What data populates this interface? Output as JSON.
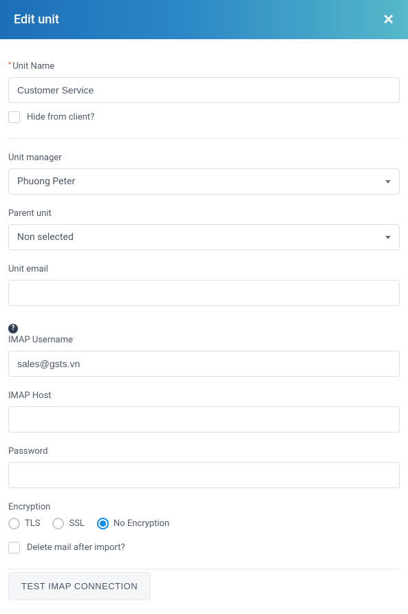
{
  "header": {
    "title": "Edit unit"
  },
  "form": {
    "unitName": {
      "label": "Unit Name",
      "value": "Customer Service",
      "required": true
    },
    "hideFromClient": {
      "label": "Hide from client?",
      "checked": false
    },
    "unitManager": {
      "label": "Unit manager",
      "selected": "Phuong Peter"
    },
    "parentUnit": {
      "label": "Parent unit",
      "selected": "Non selected"
    },
    "unitEmail": {
      "label": "Unit email",
      "value": ""
    },
    "imapUsername": {
      "label": "IMAP Username",
      "value": "sales@gsts.vn"
    },
    "imapHost": {
      "label": "IMAP Host",
      "value": ""
    },
    "password": {
      "label": "Password",
      "value": ""
    },
    "encryption": {
      "label": "Encryption",
      "options": [
        "TLS",
        "SSL",
        "No Encryption"
      ],
      "selected": "No Encryption"
    },
    "deleteAfterImport": {
      "label": "Delete mail after import?",
      "checked": false
    },
    "testImap": {
      "label": "TEST IMAP CONNECTION"
    }
  }
}
